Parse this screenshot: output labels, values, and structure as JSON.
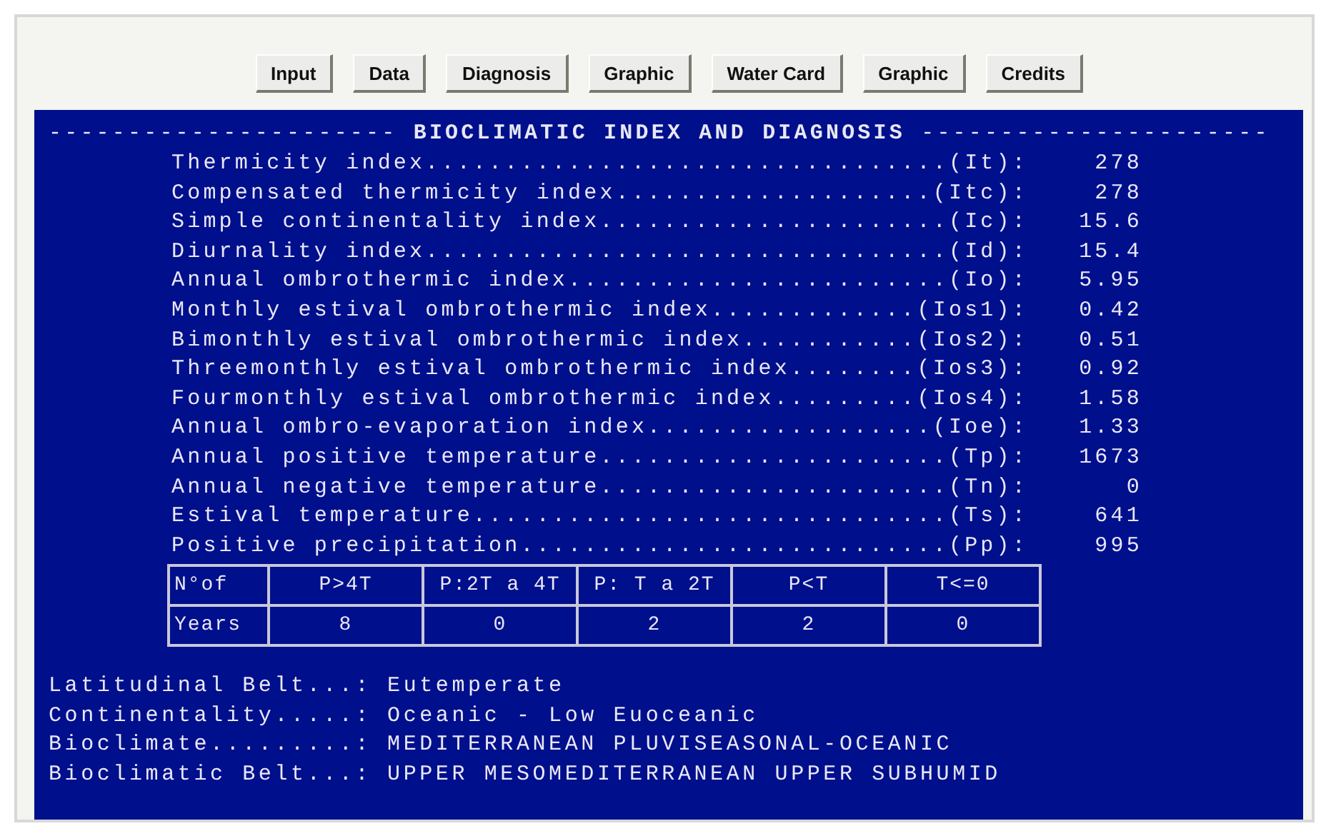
{
  "toolbar": {
    "buttons": [
      "Input",
      "Data",
      "Diagnosis",
      "Graphic",
      "Water Card",
      "Graphic",
      "Credits"
    ]
  },
  "panel": {
    "heading": "---------------------- **BIOCLIMATIC INDEX AND DIAGNOSIS** ----------------------",
    "indices": [
      {
        "label": "Thermicity index.................................(It):",
        "value": "278"
      },
      {
        "label": "Compensated thermicity index....................(Itc):",
        "value": "278"
      },
      {
        "label": "Simple continentality index......................(Ic):",
        "value": "15.6"
      },
      {
        "label": "Diurnality index.................................(Id):",
        "value": "15.4"
      },
      {
        "label": "Annual ombrothermic index........................(Io):",
        "value": "5.95"
      },
      {
        "label": "Monthly estival ombrothermic index.............(Ios1):",
        "value": "0.42"
      },
      {
        "label": "Bimonthly estival ombrothermic index...........(Ios2):",
        "value": "0.51"
      },
      {
        "label": "Threemonthly estival ombrothermic index........(Ios3):",
        "value": "0.92"
      },
      {
        "label": "Fourmonthly estival ombrothermic index.........(Ios4):",
        "value": "1.58"
      },
      {
        "label": "Annual ombro-evaporation index..................(Ioe):",
        "value": "1.33"
      },
      {
        "label": "Annual positive temperature......................(Tp):",
        "value": "1673"
      },
      {
        "label": "Annual negative temperature......................(Tn):",
        "value": "0"
      },
      {
        "label": "Estival temperature..............................(Ts):",
        "value": "641"
      },
      {
        "label": "Positive precipitation...........................(Pp):",
        "value": "995"
      }
    ],
    "years_table": {
      "header": [
        "N°of",
        "P>4T",
        "P:2T a 4T",
        "P: T a 2T",
        "P<T",
        "T<=0"
      ],
      "row": [
        "Years",
        "8",
        "0",
        "2",
        "2",
        "0"
      ]
    },
    "diagnosis": [
      {
        "label": "Latitudinal Belt...:",
        "value": "Eutemperate"
      },
      {
        "label": "Continentality.....:",
        "value": "Oceanic - Low Euoceanic"
      },
      {
        "label": "Bioclimate.........:",
        "value": "MEDITERRANEAN PLUVISEASONAL-OCEANIC"
      },
      {
        "label": "Bioclimatic Belt...:",
        "value": "UPPER MESOMEDITERRANEAN UPPER SUBHUMID"
      }
    ]
  }
}
